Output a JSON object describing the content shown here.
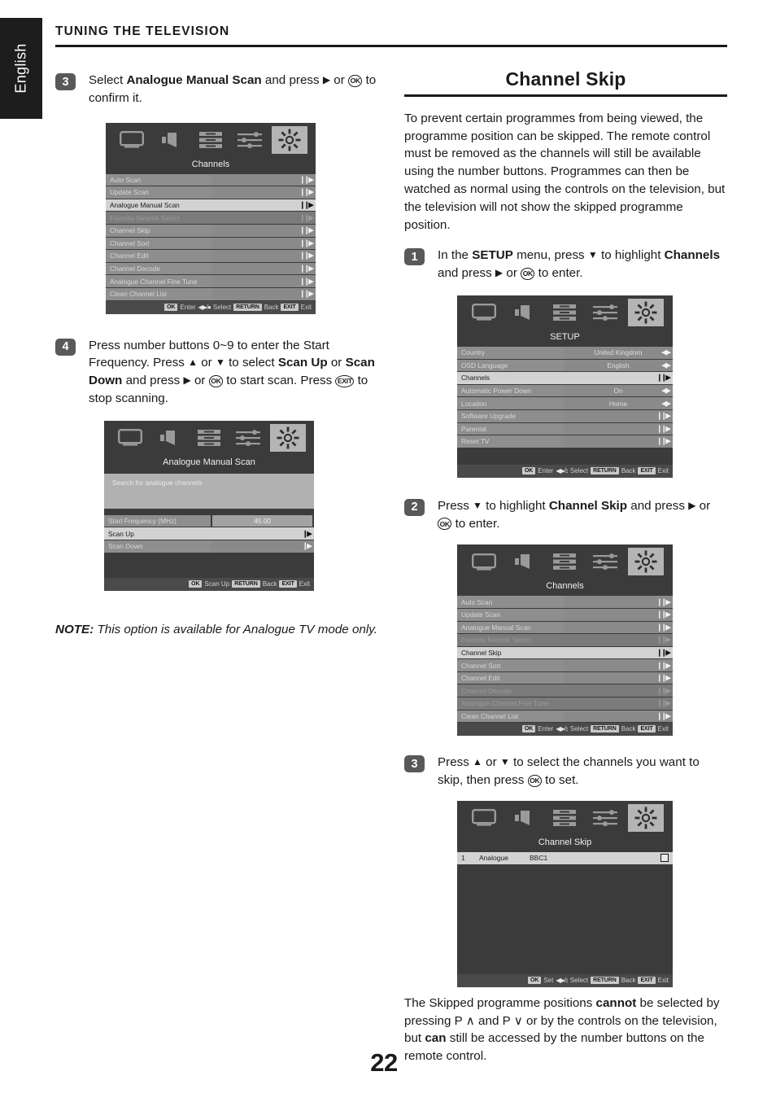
{
  "language_tab": {
    "label": "English"
  },
  "header": {
    "title": "TUNING THE TELEVISION"
  },
  "left_column": {
    "step3": {
      "number": "3",
      "text_1": "Select ",
      "bold_1": "Analogue Manual Scan",
      "text_2": " and press ",
      "arrow": "▶",
      "text_3": " or ",
      "key_ok": "OK",
      "text_4": " to confirm it."
    },
    "menu_channels": {
      "title": "Channels",
      "icons": [
        "picture-icon",
        "sound-icon",
        "list-icon",
        "settings-sliders-icon",
        "setup-gear-icon"
      ],
      "selected_icon_index": 4,
      "rows": [
        {
          "label": "Auto Scan",
          "state": "normal"
        },
        {
          "label": "Update Scan",
          "state": "normal"
        },
        {
          "label": "Analogue Manual Scan",
          "state": "selected"
        },
        {
          "label": "Favorite Nework Select",
          "state": "disabled"
        },
        {
          "label": "Channel Skip",
          "state": "normal"
        },
        {
          "label": "Channel Sort",
          "state": "normal"
        },
        {
          "label": "Channel Edit",
          "state": "normal"
        },
        {
          "label": "Channel Decode",
          "state": "normal"
        },
        {
          "label": "Analogue Channel Fine Tune",
          "state": "normal"
        },
        {
          "label": "Clean Channel List",
          "state": "normal"
        }
      ],
      "footer": {
        "ok": "OK",
        "ok_text": "Enter",
        "pad": "◀▶/●",
        "pad_text": "Select",
        "return": "RETURN",
        "return_text": "Back",
        "exit": "EXIT",
        "exit_text": "Exit"
      }
    },
    "step4": {
      "number": "4",
      "text_1": "Press number buttons 0~9 to enter the Start Frequency. Press ",
      "up": "▲",
      "text_2": " or ",
      "down": "▼",
      "text_3": " to select ",
      "bold_1": "Scan Up",
      "text_4": " or ",
      "bold_2": "Scan Down",
      "text_5": " and press ",
      "arrow": "▶",
      "text_6": " or ",
      "key_ok": "OK",
      "text_7": " to start scan. Press ",
      "key_exit": "EXIT",
      "text_8": " to stop scanning."
    },
    "menu_manual_scan": {
      "title": "Analogue Manual Scan",
      "description": "Search for analogue channels",
      "rows": [
        {
          "label": "Start Frequency (MHz)",
          "value": "45.00",
          "state": "value"
        },
        {
          "label": "Scan Up",
          "state": "selected"
        },
        {
          "label": "Scan Down",
          "state": "normal"
        }
      ],
      "footer": {
        "ok": "OK",
        "ok_text": "Scan Up",
        "return": "RETURN",
        "return_text": "Back",
        "exit": "EXIT",
        "exit_text": "Exit"
      }
    },
    "note": {
      "bold": "NOTE:",
      "text": " This option is available for Analogue TV mode only."
    }
  },
  "right_column": {
    "section_title": "Channel Skip",
    "intro": "To prevent certain programmes from being viewed, the programme position can be skipped. The remote control must be removed as the channels will still be available using the number buttons. Programmes can then be watched as normal using the controls on the television, but the television will not show the skipped programme position.",
    "step1": {
      "number": "1",
      "text_1": "In the ",
      "bold_1": "SETUP",
      "text_2": " menu, press ",
      "down": "▼",
      "text_3": " to highlight ",
      "bold_2": "Channels",
      "text_4": " and press ",
      "arrow": "▶",
      "text_5": " or ",
      "key_ok": "OK",
      "text_6": " to enter."
    },
    "menu_setup": {
      "title": "SETUP",
      "rows": [
        {
          "label": "Country",
          "value": "United Kingdom",
          "state": "normal",
          "chev": "◀▶"
        },
        {
          "label": "OSD Language",
          "value": "English",
          "state": "normal",
          "chev": "◀▶"
        },
        {
          "label": "Channels",
          "value": "",
          "state": "selected",
          "chev": "❙❙▶"
        },
        {
          "label": "Automatic Power Down",
          "value": "On",
          "state": "normal",
          "chev": "◀▶"
        },
        {
          "label": "Location",
          "value": "Home",
          "state": "normal",
          "chev": "◀▶"
        },
        {
          "label": "Software Upgrade",
          "value": "",
          "state": "normal",
          "chev": "❙❙▶"
        },
        {
          "label": "Parental",
          "value": "",
          "state": "normal",
          "chev": "❙❙▶"
        },
        {
          "label": "Reset TV",
          "value": "",
          "state": "normal",
          "chev": "❙❙▶"
        }
      ],
      "footer": {
        "ok": "OK",
        "ok_text": "Enter",
        "pad": "◀▶/↕",
        "pad_text": "Select",
        "return": "RETURN",
        "return_text": "Back",
        "exit": "EXIT",
        "exit_text": "Exit"
      }
    },
    "step2": {
      "number": "2",
      "text_1": "Press ",
      "down": "▼",
      "text_2": " to highlight ",
      "bold_1": "Channel Skip",
      "text_3": " and press ",
      "arrow": "▶",
      "text_4": " or ",
      "key_ok": "OK",
      "text_5": " to enter."
    },
    "menu_channels2": {
      "title": "Channels",
      "rows": [
        {
          "label": "Auto Scan",
          "state": "normal"
        },
        {
          "label": "Update Scan",
          "state": "normal"
        },
        {
          "label": "Analogue Manual Scan",
          "state": "normal"
        },
        {
          "label": "Favorite Nework Select",
          "state": "disabled"
        },
        {
          "label": "Channel Skip",
          "state": "selected"
        },
        {
          "label": "Channel Sort",
          "state": "normal"
        },
        {
          "label": "Channel Edit",
          "state": "normal"
        },
        {
          "label": "Channel Decode",
          "state": "disabled"
        },
        {
          "label": "Analogue Channel Fine Tune",
          "state": "disabled"
        },
        {
          "label": "Clean Channel List",
          "state": "normal"
        }
      ],
      "footer": {
        "ok": "OK",
        "ok_text": "Enter",
        "pad": "◀▶/↕",
        "pad_text": "Select",
        "return": "RETURN",
        "return_text": "Back",
        "exit": "EXIT",
        "exit_text": "Exit"
      }
    },
    "step3": {
      "number": "3",
      "text_1": "Press ",
      "up": "▲",
      "text_2": " or ",
      "down": "▼",
      "text_3": " to select the channels you want to skip, then press ",
      "key_ok": "OK",
      "text_4": " to set."
    },
    "menu_channel_skip": {
      "title": "Channel Skip",
      "channels": [
        {
          "number": "1",
          "type": "Analogue",
          "name": "BBC1",
          "checked": false
        }
      ],
      "footer": {
        "ok": "OK",
        "ok_text": "Set",
        "pad": "◀▶/↕",
        "pad_text": "Select",
        "return": "RETURN",
        "return_text": "Back",
        "exit": "EXIT",
        "exit_text": "Exit"
      }
    },
    "outro": {
      "text_1": "The Skipped programme positions ",
      "bold_1": "cannot",
      "text_2": " be selected by pressing P ",
      "up_chev": "∧",
      "text_3": " and P ",
      "down_chev": "∨",
      "text_4": " or by the controls on the television, but ",
      "bold_2": "can",
      "text_5": " still be accessed by the number buttons on the remote control."
    }
  },
  "page_number": "22",
  "colors": {
    "ink": "#1a1a1a",
    "osd_background": "#3b3b3b",
    "osd_row": "#8e8e8e",
    "osd_row_selected": "#d2d2d2",
    "osd_row_disabled": "#7b7b7b",
    "step_badge": "#58595b"
  }
}
